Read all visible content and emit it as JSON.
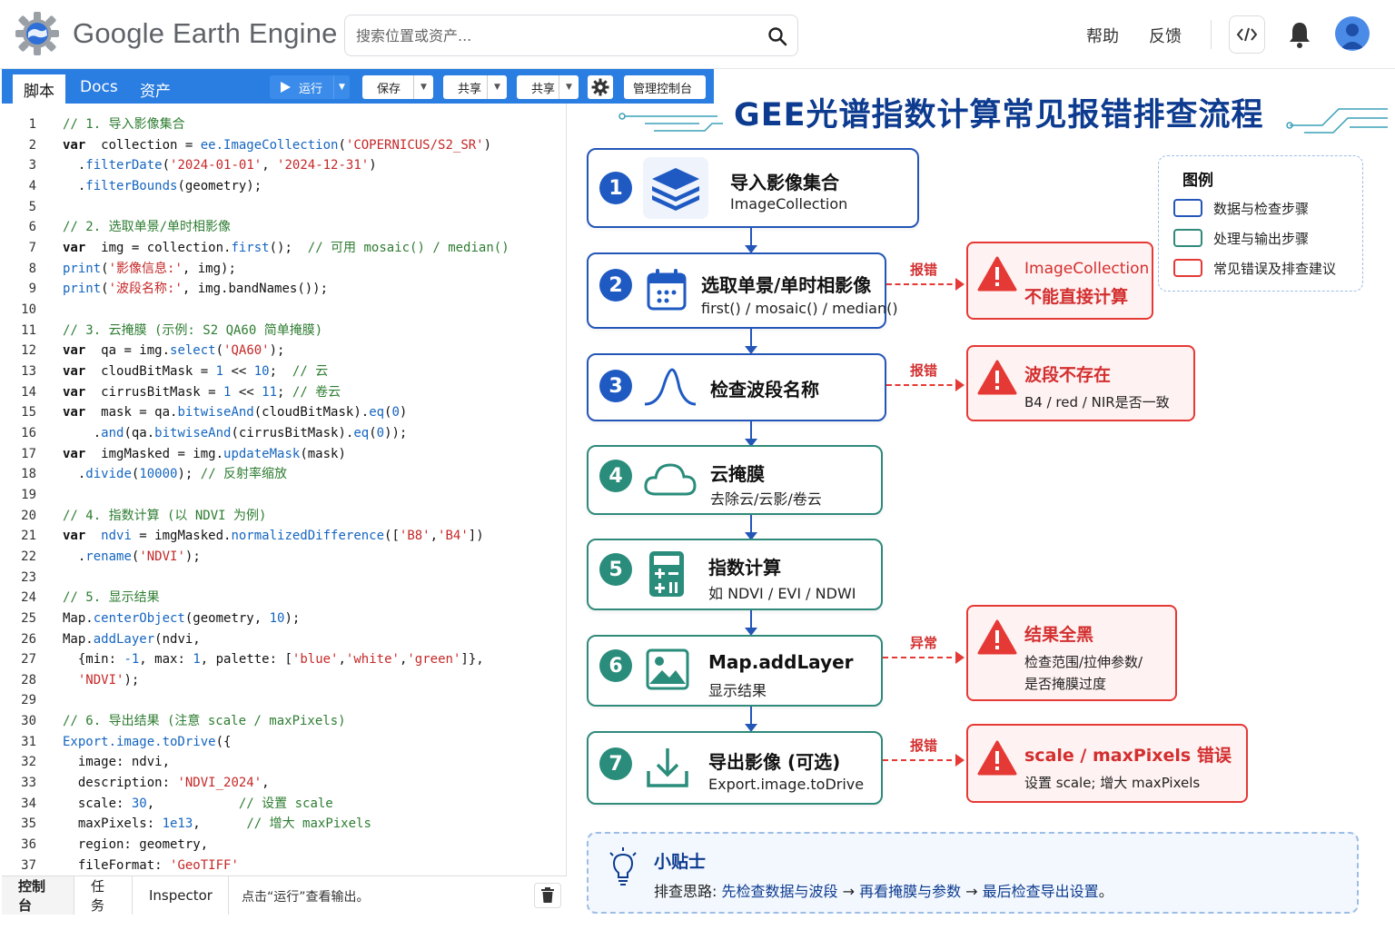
{
  "header": {
    "app_title": "Google Earth Engine",
    "search_placeholder": "搜索位置或资产...",
    "help": "帮助",
    "feedback": "反馈"
  },
  "toolbar": {
    "tab_script": "脚本",
    "tab_docs": "Docs",
    "tab_assets": "资产",
    "run": "运行",
    "save": "保存",
    "get_link": "共享",
    "share": "共享",
    "manage": "管理控制台"
  },
  "code": {
    "lines": [
      [
        [
          "c-com",
          "// 1. 导入影像集合"
        ]
      ],
      [
        [
          "c-kw",
          "var"
        ],
        [
          "",
          "  collection = "
        ],
        [
          "c-fn",
          "ee.ImageCollection"
        ],
        [
          "",
          "("
        ],
        [
          "c-str",
          "'COPERNICUS/S2_SR'"
        ],
        [
          "",
          ")"
        ]
      ],
      [
        [
          "",
          "  ."
        ],
        [
          "c-fn",
          "filterDate"
        ],
        [
          "",
          "("
        ],
        [
          "c-str",
          "'2024-01-01'"
        ],
        [
          "",
          ", "
        ],
        [
          "c-str",
          "'2024-12-31'"
        ],
        [
          "",
          ")"
        ]
      ],
      [
        [
          "",
          "  ."
        ],
        [
          "c-fn",
          "filterBounds"
        ],
        [
          "",
          "(geometry);"
        ]
      ],
      [],
      [
        [
          "c-com",
          "// 2. 选取单景/单时相影像"
        ]
      ],
      [
        [
          "c-kw",
          "var"
        ],
        [
          "",
          "  img = collection."
        ],
        [
          "c-fn",
          "first"
        ],
        [
          "",
          "();  "
        ],
        [
          "c-com",
          "// 可用 mosaic() / median()"
        ]
      ],
      [
        [
          "c-fn",
          "print"
        ],
        [
          "",
          "("
        ],
        [
          "c-str",
          "'影像信息:'"
        ],
        [
          "",
          ", img);"
        ]
      ],
      [
        [
          "c-fn",
          "print"
        ],
        [
          "",
          "("
        ],
        [
          "c-str",
          "'波段名称:'"
        ],
        [
          "",
          ", img.bandNames());"
        ]
      ],
      [],
      [
        [
          "c-com",
          "// 3. 云掩膜 (示例: S2 QA60 简单掩膜)"
        ]
      ],
      [
        [
          "c-kw",
          "var"
        ],
        [
          "",
          "  qa = img."
        ],
        [
          "c-fn",
          "select"
        ],
        [
          "",
          "("
        ],
        [
          "c-str",
          "'QA60'"
        ],
        [
          "",
          ");"
        ]
      ],
      [
        [
          "c-kw",
          "var"
        ],
        [
          "",
          "  cloudBitMask = "
        ],
        [
          "c-num",
          "1"
        ],
        [
          "",
          " << "
        ],
        [
          "c-num",
          "10"
        ],
        [
          "",
          ";  "
        ],
        [
          "c-com",
          "// 云"
        ]
      ],
      [
        [
          "c-kw",
          "var"
        ],
        [
          "",
          "  cirrusBitMask = "
        ],
        [
          "c-num",
          "1"
        ],
        [
          "",
          " << "
        ],
        [
          "c-num",
          "11"
        ],
        [
          "",
          "; "
        ],
        [
          "c-com",
          "// 卷云"
        ]
      ],
      [
        [
          "c-kw",
          "var"
        ],
        [
          "",
          "  mask = qa."
        ],
        [
          "c-fn",
          "bitwiseAnd"
        ],
        [
          "",
          "(cloudBitMask)."
        ],
        [
          "c-fn",
          "eq"
        ],
        [
          "",
          "("
        ],
        [
          "c-num",
          "0"
        ],
        [
          "",
          ")"
        ]
      ],
      [
        [
          "",
          "    ."
        ],
        [
          "c-fn",
          "and"
        ],
        [
          "",
          "(qa."
        ],
        [
          "c-fn",
          "bitwiseAnd"
        ],
        [
          "",
          "(cirrusBitMask)."
        ],
        [
          "c-fn",
          "eq"
        ],
        [
          "",
          "("
        ],
        [
          "c-num",
          "0"
        ],
        [
          "",
          "));"
        ]
      ],
      [
        [
          "c-kw",
          "var"
        ],
        [
          "",
          "  imgMasked = img."
        ],
        [
          "c-fn",
          "updateMask"
        ],
        [
          "",
          "(mask)"
        ]
      ],
      [
        [
          "",
          "  ."
        ],
        [
          "c-fn",
          "divide"
        ],
        [
          "",
          "("
        ],
        [
          "c-num",
          "10000"
        ],
        [
          "",
          "); "
        ],
        [
          "c-com",
          "// 反射率缩放"
        ]
      ],
      [],
      [
        [
          "c-com",
          "// 4. 指数计算 (以 NDVI 为例)"
        ]
      ],
      [
        [
          "c-kw",
          "var"
        ],
        [
          "",
          "  "
        ],
        [
          "c-fn",
          "ndvi"
        ],
        [
          "",
          " = imgMasked."
        ],
        [
          "c-fn",
          "normalizedDifference"
        ],
        [
          "",
          "(["
        ],
        [
          "c-str",
          "'B8'"
        ],
        [
          "",
          ","
        ],
        [
          "c-str",
          "'B4'"
        ],
        [
          "",
          "])"
        ]
      ],
      [
        [
          "",
          "  ."
        ],
        [
          "c-fn",
          "rename"
        ],
        [
          "",
          "("
        ],
        [
          "c-str",
          "'NDVI'"
        ],
        [
          "",
          ");"
        ]
      ],
      [],
      [
        [
          "c-com",
          "// 5. 显示结果"
        ]
      ],
      [
        [
          "",
          "Map."
        ],
        [
          "c-fn",
          "centerObject"
        ],
        [
          "",
          "(geometry, "
        ],
        [
          "c-num",
          "10"
        ],
        [
          "",
          ");"
        ]
      ],
      [
        [
          "",
          "Map."
        ],
        [
          "c-fn",
          "addLayer"
        ],
        [
          "",
          "(ndvi,"
        ]
      ],
      [
        [
          "",
          "  {min: "
        ],
        [
          "c-num",
          "-1"
        ],
        [
          "",
          ", max: "
        ],
        [
          "c-num",
          "1"
        ],
        [
          "",
          ", palette: ["
        ],
        [
          "c-str",
          "'blue'"
        ],
        [
          "",
          ","
        ],
        [
          "c-str",
          "'white'"
        ],
        [
          "",
          ","
        ],
        [
          "c-str",
          "'green'"
        ],
        [
          "",
          "]},"
        ]
      ],
      [
        [
          "",
          "  "
        ],
        [
          "c-str",
          "'NDVI'"
        ],
        [
          "",
          ");"
        ]
      ],
      [],
      [
        [
          "c-com",
          "// 6. 导出结果 (注意 scale / maxPixels)"
        ]
      ],
      [
        [
          "c-fn",
          "Export.image.toDrive"
        ],
        [
          "",
          "({"
        ]
      ],
      [
        [
          "",
          "  image: ndvi,"
        ]
      ],
      [
        [
          "",
          "  description: "
        ],
        [
          "c-str",
          "'NDVI_2024'"
        ],
        [
          "",
          ","
        ]
      ],
      [
        [
          "",
          "  scale: "
        ],
        [
          "c-num",
          "30"
        ],
        [
          "",
          ",           "
        ],
        [
          "c-com",
          "// 设置 scale"
        ]
      ],
      [
        [
          "",
          "  maxPixels: "
        ],
        [
          "c-num",
          "1e13"
        ],
        [
          "",
          ",      "
        ],
        [
          "c-com",
          "// 增大 maxPixels"
        ]
      ],
      [
        [
          "",
          "  region: geometry,"
        ]
      ],
      [
        [
          "",
          "  fileFormat: "
        ],
        [
          "c-str",
          "'GeoTIFF'"
        ]
      ],
      [
        [
          "",
          "});"
        ]
      ]
    ]
  },
  "console": {
    "tab_console": "控制台",
    "tab_tasks": "任务",
    "tab_inspector": "Inspector",
    "message": "点击“运行”查看输出。"
  },
  "infographic": {
    "title": "GEE光谱指数计算常见报错排查流程",
    "steps": [
      {
        "num": "1",
        "title": "导入影像集合",
        "sub": "ImageCollection",
        "icon": "layers-icon"
      },
      {
        "num": "2",
        "title": "选取单景/单时相影像",
        "sub": "first() / mosaic() / median()",
        "icon": "calendar-icon"
      },
      {
        "num": "3",
        "title": "检查波段名称",
        "sub": "",
        "icon": "spectrum-curve-icon"
      },
      {
        "num": "4",
        "title": "云掩膜",
        "sub": "去除云/云影/卷云",
        "icon": "cloud-icon"
      },
      {
        "num": "5",
        "title": "指数计算",
        "sub": "如 NDVI / EVI / NDWI",
        "icon": "calculator-icon"
      },
      {
        "num": "6",
        "title": "Map.addLayer",
        "sub": "显示结果",
        "icon": "image-icon"
      },
      {
        "num": "7",
        "title": "导出影像 (可选)",
        "sub": "Export.image.toDrive",
        "icon": "download-icon"
      }
    ],
    "errors": [
      {
        "label": "报错",
        "title1": "ImageCollection",
        "title2": "不能直接计算",
        "sub1": "",
        "sub2": ""
      },
      {
        "label": "报错",
        "title1": "波段不存在",
        "title2": "",
        "sub1": "B4 / red / NIR是否一致",
        "sub2": ""
      },
      {
        "label": "异常",
        "title1": "结果全黑",
        "title2": "",
        "sub1": "检查范围/拉伸参数/",
        "sub2": "是否掩膜过度"
      },
      {
        "label": "报错",
        "title1": "scale / maxPixels 错误",
        "title2": "",
        "sub1": "设置 scale; 增大 maxPixels",
        "sub2": ""
      }
    ],
    "legend": {
      "title": "图例",
      "items": [
        {
          "label": "数据与检查步骤",
          "color": "#2456b8"
        },
        {
          "label": "处理与输出步骤",
          "color": "#2f8a7a"
        },
        {
          "label": "常见错误及排查建议",
          "color": "#e53935"
        }
      ]
    },
    "tip": {
      "title": "小贴士",
      "prefix": "排查思路: ",
      "s1": "先检查数据与波段",
      "arrow": " → ",
      "s2": "再看掩膜与参数",
      "s3": "最后检查导出设置",
      "suffix": "。"
    }
  },
  "colors": {
    "accent_blue": "#2a7de1",
    "step_blue": "#2456b8",
    "step_green": "#2f8a7a",
    "error_red": "#e53935",
    "title_navy": "#0d3b8f"
  }
}
